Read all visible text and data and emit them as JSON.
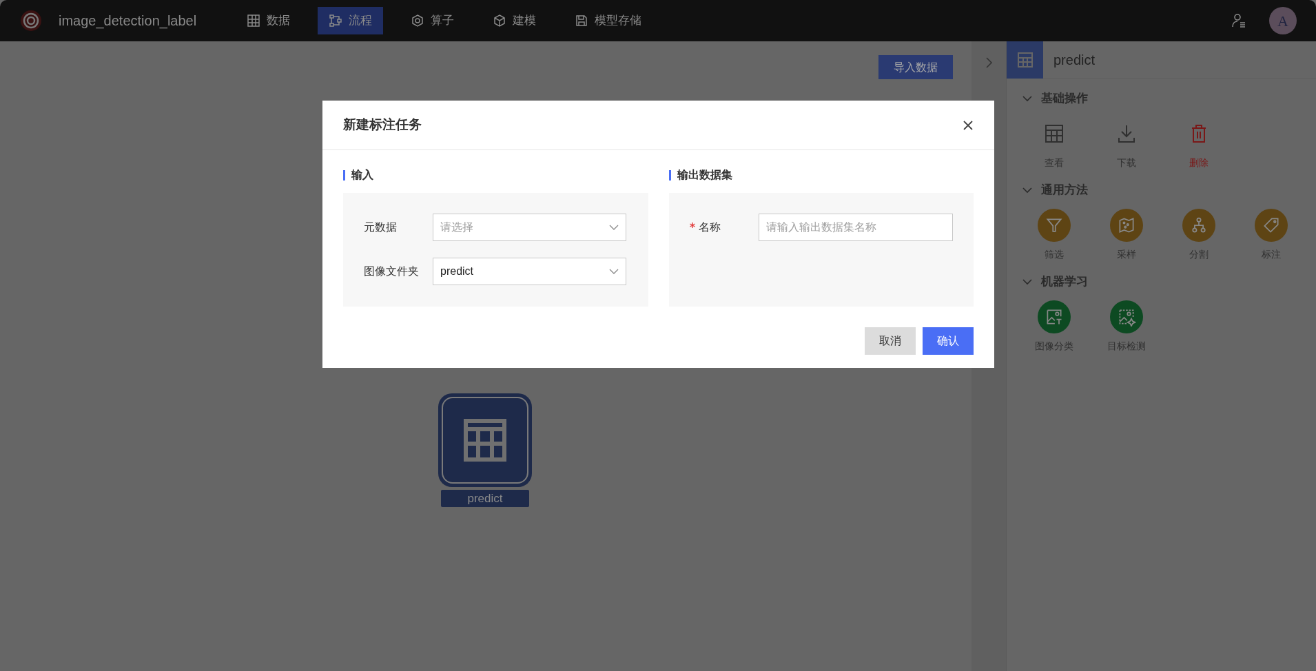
{
  "app": {
    "title": "image_detection_label"
  },
  "nav": [
    {
      "label": "数据",
      "selected": false
    },
    {
      "label": "流程",
      "selected": true
    },
    {
      "label": "算子",
      "selected": false
    },
    {
      "label": "建模",
      "selected": false
    },
    {
      "label": "模型存储",
      "selected": false
    }
  ],
  "user": {
    "avatar": "A"
  },
  "canvas": {
    "import_button": "导入数据",
    "node": {
      "label": "predict"
    }
  },
  "panel": {
    "title": "predict",
    "sections": [
      {
        "title": "基础操作",
        "expanded": true,
        "items": [
          {
            "label": "查看",
            "kind": "plain"
          },
          {
            "label": "下载",
            "kind": "plain"
          },
          {
            "label": "删除",
            "kind": "danger"
          }
        ]
      },
      {
        "title": "通用方法",
        "expanded": true,
        "items": [
          {
            "label": "筛选",
            "kind": "general"
          },
          {
            "label": "采样",
            "kind": "general"
          },
          {
            "label": "分割",
            "kind": "general"
          },
          {
            "label": "标注",
            "kind": "general"
          }
        ]
      },
      {
        "title": "机器学习",
        "expanded": true,
        "items": [
          {
            "label": "图像分类",
            "kind": "ml"
          },
          {
            "label": "目标检测",
            "kind": "ml"
          }
        ]
      }
    ]
  },
  "dialog": {
    "title": "新建标注任务",
    "sections": [
      {
        "title": "输入",
        "fields": [
          {
            "label": "元数据",
            "kind": "select",
            "placeholder": "请选择"
          },
          {
            "label": "图像文件夹",
            "kind": "select",
            "value": "predict"
          }
        ]
      },
      {
        "title": "输出数据集",
        "fields": [
          {
            "label": "名称",
            "kind": "text",
            "required": true,
            "placeholder": "请输入输出数据集名称"
          }
        ]
      }
    ],
    "buttons": [
      {
        "label": "取消",
        "kind": "secondary"
      },
      {
        "label": "确认",
        "kind": "primary"
      }
    ]
  }
}
